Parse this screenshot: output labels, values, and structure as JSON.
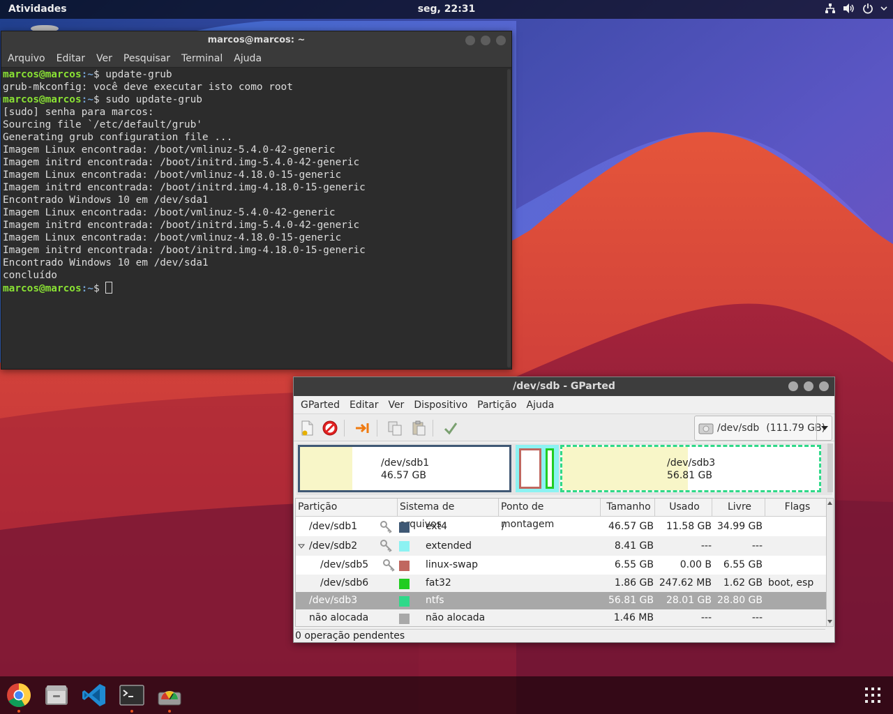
{
  "topbar": {
    "activities": "Atividades",
    "clock": "seg, 22:31",
    "tray_icons": [
      "network-icon",
      "volume-icon",
      "power-icon"
    ]
  },
  "terminal": {
    "title": "marcos@marcos: ~",
    "menu": [
      "Arquivo",
      "Editar",
      "Ver",
      "Pesquisar",
      "Terminal",
      "Ajuda"
    ],
    "prompt_user": "marcos@marcos",
    "prompt_path": ":~",
    "prompt_symbol": "$ ",
    "lines": [
      {
        "prompt": true,
        "text": "update-grub"
      },
      {
        "prompt": false,
        "text": "grub-mkconfig: você deve executar isto como root"
      },
      {
        "prompt": true,
        "text": "sudo update-grub"
      },
      {
        "prompt": false,
        "text": "[sudo] senha para marcos:"
      },
      {
        "prompt": false,
        "text": "Sourcing file `/etc/default/grub'"
      },
      {
        "prompt": false,
        "text": "Generating grub configuration file ..."
      },
      {
        "prompt": false,
        "text": "Imagem Linux encontrada: /boot/vmlinuz-5.4.0-42-generic"
      },
      {
        "prompt": false,
        "text": "Imagem initrd encontrada: /boot/initrd.img-5.4.0-42-generic"
      },
      {
        "prompt": false,
        "text": "Imagem Linux encontrada: /boot/vmlinuz-4.18.0-15-generic"
      },
      {
        "prompt": false,
        "text": "Imagem initrd encontrada: /boot/initrd.img-4.18.0-15-generic"
      },
      {
        "prompt": false,
        "text": "Encontrado Windows 10 em /dev/sda1"
      },
      {
        "prompt": false,
        "text": "Imagem Linux encontrada: /boot/vmlinuz-5.4.0-42-generic"
      },
      {
        "prompt": false,
        "text": "Imagem initrd encontrada: /boot/initrd.img-5.4.0-42-generic"
      },
      {
        "prompt": false,
        "text": "Imagem Linux encontrada: /boot/vmlinuz-4.18.0-15-generic"
      },
      {
        "prompt": false,
        "text": "Imagem initrd encontrada: /boot/initrd.img-4.18.0-15-generic"
      },
      {
        "prompt": false,
        "text": "Encontrado Windows 10 em /dev/sda1"
      },
      {
        "prompt": false,
        "text": "concluído"
      },
      {
        "prompt": true,
        "text": "",
        "cursor": true
      }
    ]
  },
  "gparted": {
    "title": "/dev/sdb - GParted",
    "menu": [
      "GParted",
      "Editar",
      "Ver",
      "Dispositivo",
      "Partição",
      "Ajuda"
    ],
    "toolbar_icons": [
      "new-partition-icon",
      "delete-icon",
      "resize-move-icon",
      "copy-icon",
      "paste-icon",
      "apply-icon"
    ],
    "device": {
      "name": "/dev/sdb",
      "size": "(111.79 GB)"
    },
    "graphic": {
      "sdb1": {
        "name": "/dev/sdb1",
        "size": "46.57 GB",
        "used_fraction": 0.25
      },
      "sdb3": {
        "name": "/dev/sdb3",
        "size": "56.81 GB",
        "used_fraction": 0.49
      }
    },
    "columns": [
      "Partição",
      "Sistema de arquivos",
      "Ponto de montagem",
      "Tamanho",
      "Usado",
      "Livre",
      "Flags"
    ],
    "rows": [
      {
        "partition": "/dev/sdb1",
        "indent": 0,
        "expander": false,
        "key": true,
        "fs_color": "#3f5874",
        "fs": "ext4",
        "mount": "/",
        "size": "46.57 GB",
        "used": "11.58 GB",
        "free": "34.99 GB",
        "flags": ""
      },
      {
        "partition": "/dev/sdb2",
        "indent": 0,
        "expander": true,
        "key": true,
        "fs_color": "#8cf2f2",
        "fs": "extended",
        "mount": "",
        "size": "8.41 GB",
        "used": "---",
        "free": "---",
        "flags": ""
      },
      {
        "partition": "/dev/sdb5",
        "indent": 1,
        "expander": false,
        "key": true,
        "fs_color": "#c0675f",
        "fs": "linux-swap",
        "mount": "",
        "size": "6.55 GB",
        "used": "0.00 B",
        "free": "6.55 GB",
        "flags": ""
      },
      {
        "partition": "/dev/sdb6",
        "indent": 1,
        "expander": false,
        "key": false,
        "fs_color": "#21cc21",
        "fs": "fat32",
        "mount": "",
        "size": "1.86 GB",
        "used": "247.62 MB",
        "free": "1.62 GB",
        "flags": "boot, esp"
      },
      {
        "partition": "/dev/sdb3",
        "indent": 0,
        "expander": false,
        "key": false,
        "fs_color": "#2fd989",
        "fs": "ntfs",
        "mount": "",
        "size": "56.81 GB",
        "used": "28.01 GB",
        "free": "28.80 GB",
        "flags": "",
        "selected": true
      },
      {
        "partition": "não alocada",
        "indent": 0,
        "expander": false,
        "key": false,
        "fs_color": "#a9a9a9",
        "fs": "não alocada",
        "mount": "",
        "size": "1.46 MB",
        "used": "---",
        "free": "---",
        "flags": ""
      }
    ],
    "status": "0 operação pendentes"
  },
  "dock": {
    "apps": [
      {
        "name": "chrome-icon",
        "running": true
      },
      {
        "name": "files-icon",
        "running": false
      },
      {
        "name": "vscode-icon",
        "running": false
      },
      {
        "name": "terminal-icon",
        "running": true
      },
      {
        "name": "gparted-icon",
        "running": true
      }
    ],
    "show_apps": "apps-grid-icon"
  }
}
